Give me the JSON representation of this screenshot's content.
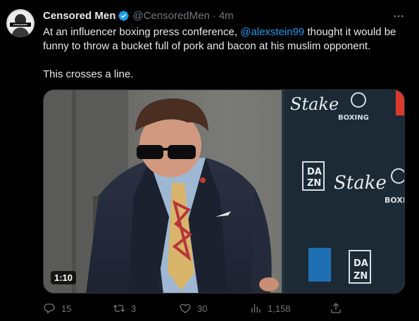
{
  "author": {
    "display_name": "Censored Men",
    "handle": "@CensoredMen",
    "separator": "·",
    "time": "4m",
    "verified": true,
    "avatar_label": "CENSORED"
  },
  "tweet": {
    "text_before_mention": "At an influencer boxing press conference, ",
    "mention": "@alexstein99",
    "text_after_mention": " thought it would be funny to throw a bucket full of pork and bacon at his muslim opponent.",
    "second_paragraph": "This crosses a line."
  },
  "media": {
    "duration": "1:10",
    "backdrop_text": [
      "Stake",
      "BOXING",
      "DA",
      "ZN",
      "Stake",
      "BOXI",
      "DA",
      "ZN"
    ]
  },
  "actions": {
    "reply_count": "15",
    "retweet_count": "3",
    "like_count": "30",
    "view_count": "1,158"
  },
  "colors": {
    "background": "#000000",
    "text": "#e7e9ea",
    "muted": "#71767b",
    "link": "#1d9bf0",
    "verified_badge": "#1d9bf0"
  }
}
